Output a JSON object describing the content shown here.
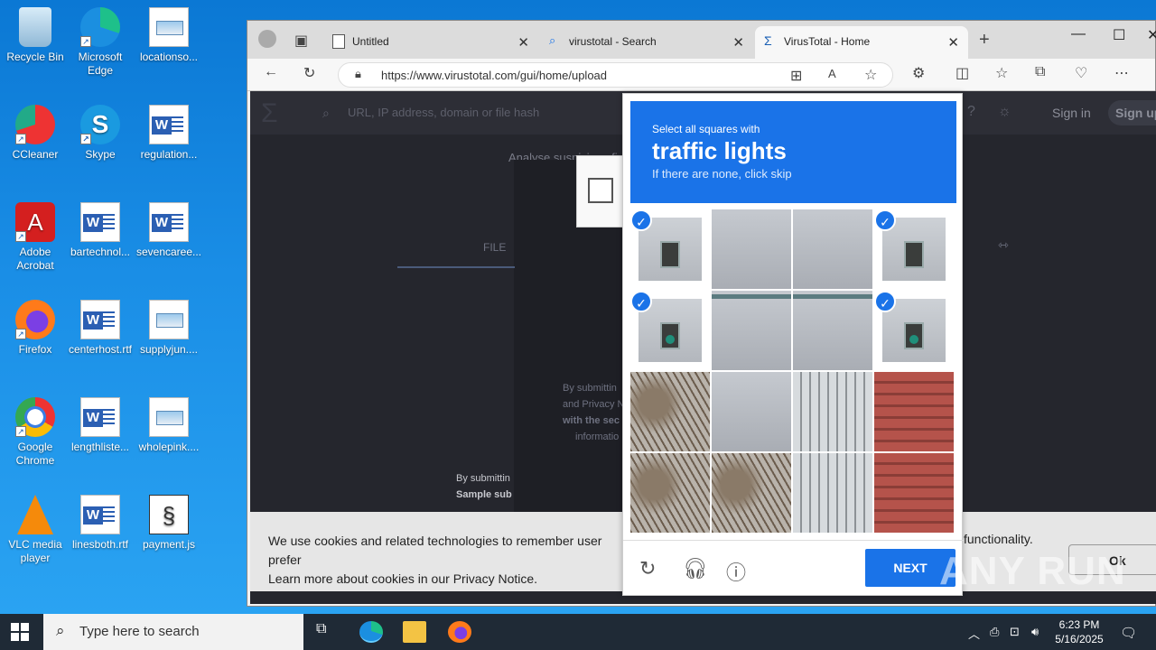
{
  "desktop": {
    "icons": [
      {
        "label": "Recycle Bin"
      },
      {
        "label": "Microsoft Edge"
      },
      {
        "label": "locationso..."
      },
      {
        "label": "CCleaner"
      },
      {
        "label": "Skype"
      },
      {
        "label": "regulation..."
      },
      {
        "label": "Adobe Acrobat"
      },
      {
        "label": "bartechnol..."
      },
      {
        "label": "sevencaree..."
      },
      {
        "label": "Firefox"
      },
      {
        "label": "centerhost.rtf"
      },
      {
        "label": "supplyjun...."
      },
      {
        "label": "Google Chrome"
      },
      {
        "label": "lengthliste..."
      },
      {
        "label": "wholepink...."
      },
      {
        "label": "VLC media player"
      },
      {
        "label": "linesboth.rtf"
      },
      {
        "label": "payment.js"
      }
    ]
  },
  "browser": {
    "tabs": [
      {
        "label": "Untitled"
      },
      {
        "label": "virustotal - Search"
      },
      {
        "label": "VirusTotal - Home"
      }
    ],
    "url": "https://www.virustotal.com/gui/home/upload",
    "page": {
      "search_placeholder": "URL, IP address, domain or file hash",
      "sign_in": "Sign in",
      "sign_up": "Sign up",
      "analyse": "Analyse suspicious fi",
      "file_tab": "FILE",
      "by_submitting_1": "By submittin",
      "by_submitting_1b": "and Privacy N",
      "by_submitting_1c": "with the sec",
      "by_submitting_1d": "informatio",
      "by_submitting_2": "By submittin",
      "by_submitting_2b": "Sample sub",
      "right_frag_1": "ur",
      "right_frag_2": "."
    },
    "cookie": {
      "line1": "We use cookies and related technologies to remember user prefer",
      "line2_prefix": "Learn more about cookies in our ",
      "link": "Privacy Notice",
      "line2_suffix": ".",
      "right_text": "functionality.",
      "ok": "Ok"
    }
  },
  "captcha": {
    "line1": "Select all squares with",
    "line2": "traffic lights",
    "line3": "If there are none, click skip",
    "next": "NEXT"
  },
  "watermark": "ANY RUN",
  "taskbar": {
    "search_placeholder": "Type here to search",
    "time": "6:23 PM",
    "date": "5/16/2025"
  }
}
